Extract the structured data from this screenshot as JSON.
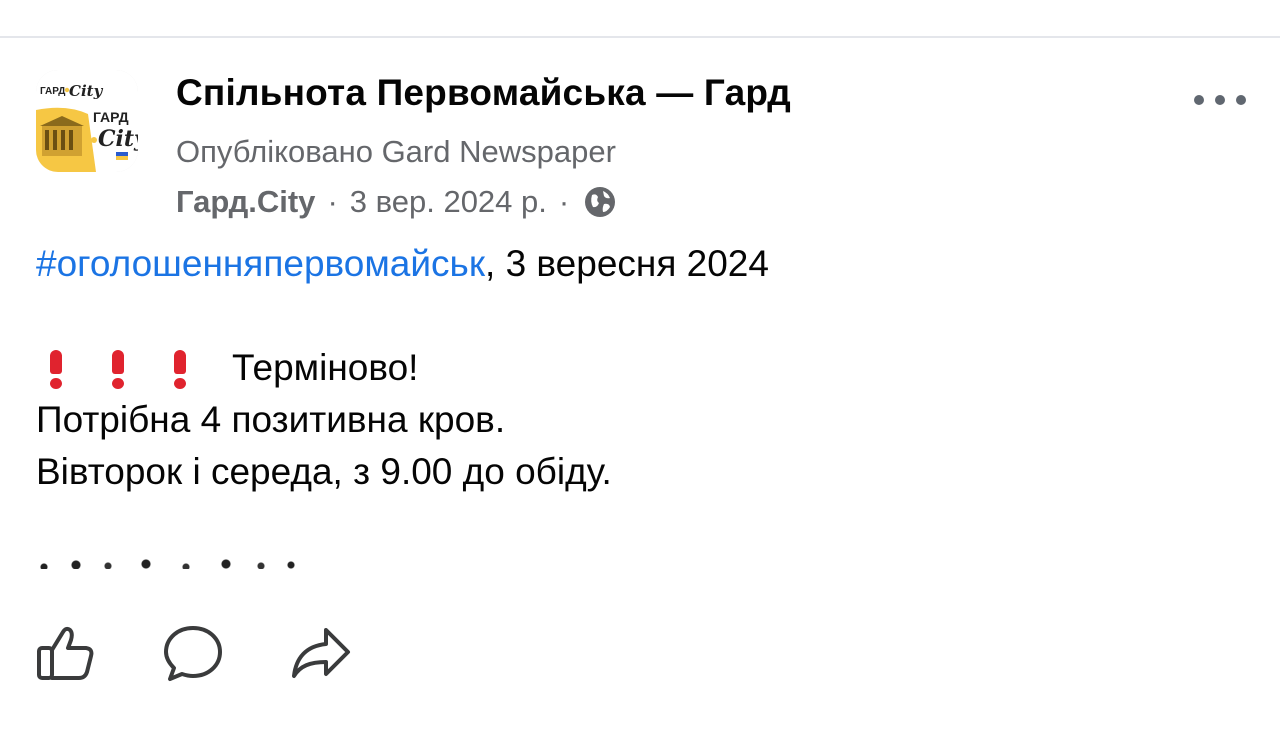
{
  "post": {
    "group_name": "Спільнота Первомайська — Гард",
    "published_by": "Опубліковано Gard Newspaper",
    "page_name": "Гард.City",
    "separator": "·",
    "date": "3 вер. 2024 р.",
    "privacy_icon": "globe-icon",
    "more_icon": "more-horizontal-icon",
    "avatar": {
      "logo_text_small": "ГАРД",
      "logo_script_small": "City",
      "logo_text_big": "ГАРД",
      "logo_script_big": "City"
    }
  },
  "body": {
    "hashtag": "#оголошенняпервомайськ",
    "hashtag_suffix": ", 3 вересня 2024",
    "urgent_label": "Терміново!",
    "line2": "Потрібна 4 позитивна кров.",
    "line3": "Вівторок і середа, з 9.00 до обіду."
  },
  "actions": [
    {
      "icon": "like-icon"
    },
    {
      "icon": "comment-icon"
    },
    {
      "icon": "share-icon"
    }
  ],
  "colors": {
    "hashtag": "#1b74e4",
    "meta_gray": "#65676b",
    "exclamation_red": "#e0232e",
    "logo_yellow": "#f6c744"
  }
}
